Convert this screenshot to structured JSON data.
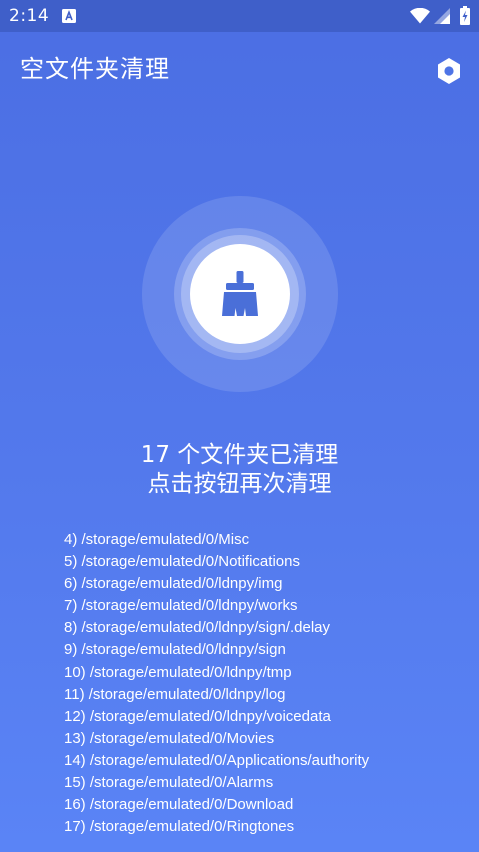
{
  "status_bar": {
    "time": "2:14"
  },
  "app_bar": {
    "title": "空文件夹清理",
    "settings_icon": "settings-hex-icon"
  },
  "clean_button": {
    "icon": "broom-icon"
  },
  "result": {
    "line1": "17 个文件夹已清理",
    "line2": "点击按钮再次清理"
  },
  "log": [
    "4) /storage/emulated/0/Misc",
    "5) /storage/emulated/0/Notifications",
    "6) /storage/emulated/0/ldnpy/img",
    "7) /storage/emulated/0/ldnpy/works",
    "8) /storage/emulated/0/ldnpy/sign/.delay",
    "9) /storage/emulated/0/ldnpy/sign",
    "10) /storage/emulated/0/ldnpy/tmp",
    "11) /storage/emulated/0/ldnpy/log",
    "12) /storage/emulated/0/ldnpy/voicedata",
    "13) /storage/emulated/0/Movies",
    "14) /storage/emulated/0/Applications/authority",
    "15) /storage/emulated/0/Alarms",
    "16) /storage/emulated/0/Download",
    "17) /storage/emulated/0/Ringtones"
  ],
  "colors": {
    "background": "#5379ec",
    "status_bar": "#3f5fc9",
    "accent": "#4a6fd8"
  }
}
